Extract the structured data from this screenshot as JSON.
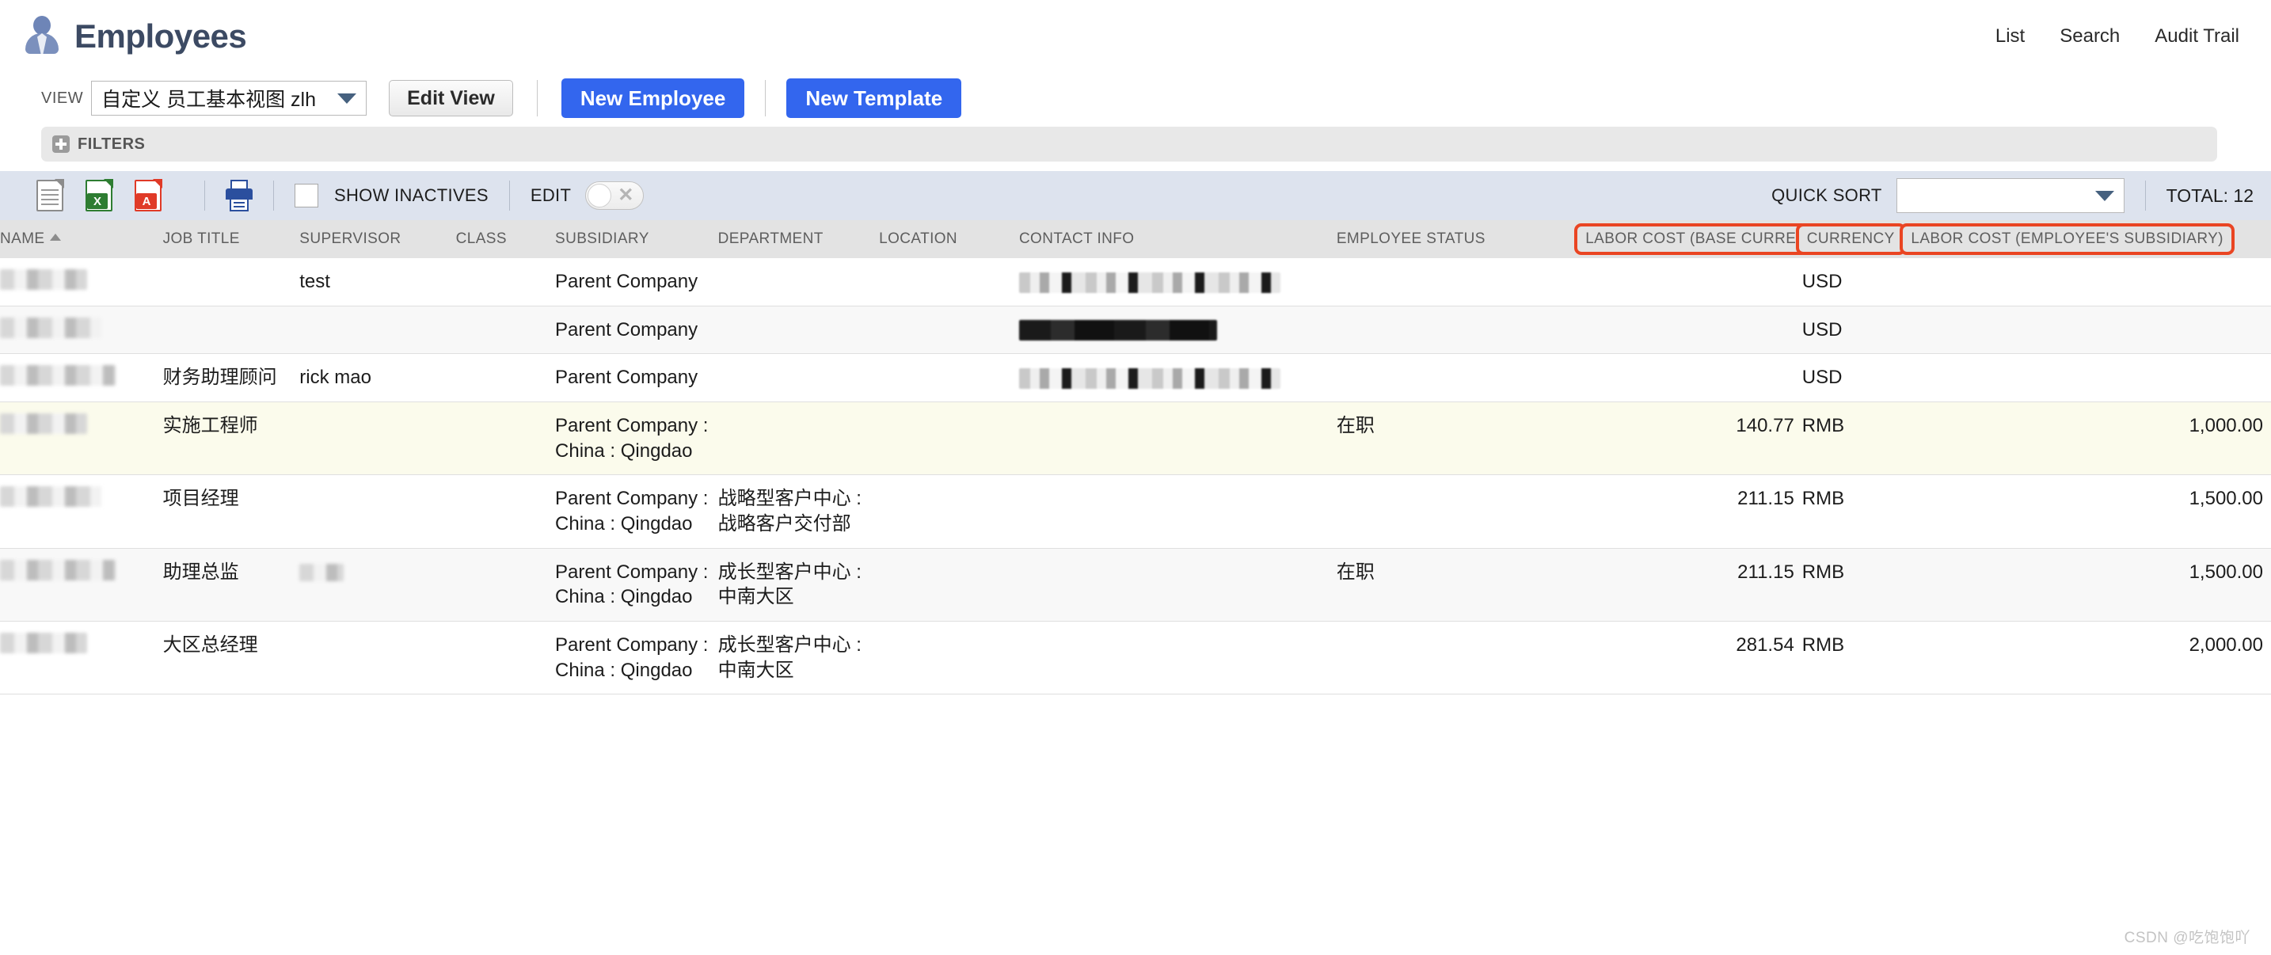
{
  "header": {
    "title": "Employees",
    "icon": "person-icon",
    "nav": [
      {
        "label": "List"
      },
      {
        "label": "Search"
      },
      {
        "label": "Audit Trail"
      }
    ]
  },
  "viewbar": {
    "view_label": "VIEW",
    "view_value": "自定义 员工基本视图 zlh",
    "edit_view_label": "Edit View",
    "new_employee_label": "New Employee",
    "new_template_label": "New Template",
    "accent_blue": "#3366ee"
  },
  "filters": {
    "label": "FILTERS",
    "expand_icon": "plus-icon"
  },
  "toolbar": {
    "icons": [
      {
        "name": "export-csv-icon",
        "badge": ""
      },
      {
        "name": "export-excel-icon",
        "badge": "X"
      },
      {
        "name": "export-pdf-icon",
        "badge": "A"
      },
      {
        "name": "print-icon",
        "badge": ""
      }
    ],
    "show_inactives_label": "SHOW INACTIVES",
    "show_inactives_checked": false,
    "edit_label": "EDIT",
    "edit_toggle_state": "off",
    "quick_sort_label": "QUICK SORT",
    "quick_sort_value": "",
    "total_label": "TOTAL: 12"
  },
  "table": {
    "sort_column": "NAME",
    "sort_direction": "asc",
    "highlight_color": "#ea4522",
    "columns": [
      {
        "label": "NAME",
        "align": "left",
        "sorted": true,
        "highlighted": false
      },
      {
        "label": "JOB TITLE",
        "align": "left",
        "highlighted": false
      },
      {
        "label": "SUPERVISOR",
        "align": "left",
        "highlighted": false
      },
      {
        "label": "CLASS",
        "align": "left",
        "highlighted": false
      },
      {
        "label": "SUBSIDIARY",
        "align": "left",
        "highlighted": false
      },
      {
        "label": "DEPARTMENT",
        "align": "left",
        "highlighted": false
      },
      {
        "label": "LOCATION",
        "align": "left",
        "highlighted": false
      },
      {
        "label": "CONTACT INFO",
        "align": "left",
        "highlighted": false
      },
      {
        "label": "EMPLOYEE STATUS",
        "align": "left",
        "highlighted": false
      },
      {
        "label": "LABOR COST (BASE CURRENCY)",
        "align": "right",
        "highlighted": true
      },
      {
        "label": "CURRENCY",
        "align": "left",
        "highlighted": true
      },
      {
        "label": "LABOR COST (EMPLOYEE'S SUBSIDIARY)",
        "align": "right",
        "highlighted": true
      }
    ],
    "rows": [
      {
        "name": "",
        "name_redacted": true,
        "name_style": "soft",
        "job_title": "",
        "supervisor": "test",
        "class": "",
        "subsidiary": "Parent Company",
        "department": "",
        "location": "",
        "contact_info": "",
        "contact_redacted": true,
        "contact_style": "mixed",
        "employee_status": "",
        "labor_cost_base": "",
        "currency": "USD",
        "labor_cost_subsidiary": "",
        "row_style": "plain"
      },
      {
        "name": "",
        "name_redacted": true,
        "name_style": "soft",
        "job_title": "",
        "supervisor": "",
        "class": "",
        "subsidiary": "Parent Company",
        "department": "",
        "location": "",
        "contact_info": "",
        "contact_redacted": true,
        "contact_style": "dark",
        "employee_status": "",
        "labor_cost_base": "",
        "currency": "USD",
        "labor_cost_subsidiary": "",
        "row_style": "alt"
      },
      {
        "name": "",
        "name_redacted": true,
        "name_style": "soft",
        "job_title": "财务助理顾问",
        "supervisor": "rick mao",
        "class": "",
        "subsidiary": "Parent Company",
        "department": "",
        "location": "",
        "contact_info": "",
        "contact_redacted": true,
        "contact_style": "mixed",
        "employee_status": "",
        "labor_cost_base": "",
        "currency": "USD",
        "labor_cost_subsidiary": "",
        "row_style": "plain"
      },
      {
        "name": "",
        "name_redacted": true,
        "name_style": "soft",
        "job_title": "实施工程师",
        "supervisor": "",
        "class": "",
        "subsidiary": "Parent Company : China : Qingdao",
        "department": "",
        "location": "",
        "contact_info": "",
        "contact_redacted": false,
        "contact_style": "none",
        "employee_status": "在职",
        "labor_cost_base": "140.77",
        "currency": "RMB",
        "labor_cost_subsidiary": "1,000.00",
        "row_style": "hot"
      },
      {
        "name": "",
        "name_redacted": true,
        "name_style": "soft",
        "job_title": "项目经理",
        "supervisor": "",
        "class": "",
        "subsidiary": "Parent Company : China : Qingdao",
        "department": "战略型客户中心 : 战略客户交付部",
        "location": "",
        "contact_info": "",
        "contact_redacted": false,
        "contact_style": "none",
        "employee_status": "",
        "labor_cost_base": "211.15",
        "currency": "RMB",
        "labor_cost_subsidiary": "1,500.00",
        "row_style": "plain"
      },
      {
        "name": "",
        "name_redacted": true,
        "name_style": "soft",
        "job_title": "助理总监",
        "supervisor": "",
        "supervisor_redacted": true,
        "class": "",
        "subsidiary": "Parent Company : China : Qingdao",
        "department": "成长型客户中心 : 中南大区",
        "location": "",
        "contact_info": "",
        "contact_redacted": false,
        "contact_style": "none",
        "employee_status": "在职",
        "labor_cost_base": "211.15",
        "currency": "RMB",
        "labor_cost_subsidiary": "1,500.00",
        "row_style": "alt"
      },
      {
        "name": "",
        "name_redacted": true,
        "name_style": "soft",
        "job_title": "大区总经理",
        "supervisor": "",
        "class": "",
        "subsidiary": "Parent Company : China : Qingdao",
        "department": "成长型客户中心 : 中南大区",
        "location": "",
        "contact_info": "",
        "contact_redacted": false,
        "contact_style": "none",
        "employee_status": "",
        "labor_cost_base": "281.54",
        "currency": "RMB",
        "labor_cost_subsidiary": "2,000.00",
        "row_style": "plain"
      }
    ]
  },
  "watermark": "CSDN @吃饱饱吖"
}
